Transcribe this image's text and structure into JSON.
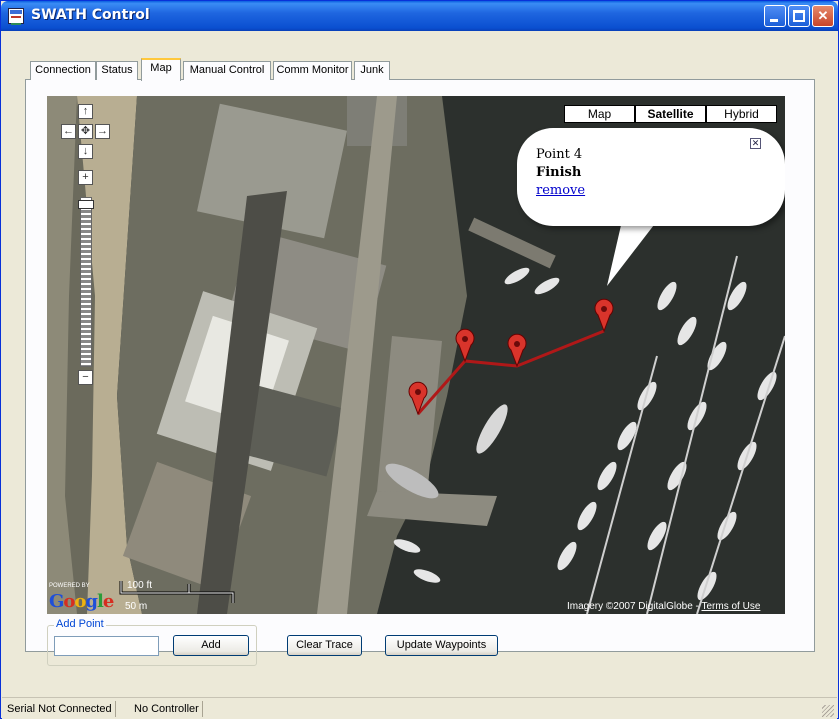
{
  "window": {
    "title": "SWATH Control"
  },
  "tabs": [
    {
      "label": "Connection"
    },
    {
      "label": "Status"
    },
    {
      "label": "Map"
    },
    {
      "label": "Manual Control"
    },
    {
      "label": "Comm Monitor"
    },
    {
      "label": "Junk"
    }
  ],
  "active_tab": "Map",
  "map": {
    "type_buttons": [
      "Map",
      "Satellite",
      "Hybrid"
    ],
    "selected_type": "Satellite",
    "info_window": {
      "line1": "Point 4",
      "line2": "Finish",
      "link": "remove"
    },
    "powered_by": "POWERED BY",
    "logo": "Google",
    "scale_ft": "100 ft",
    "scale_m": "50 m",
    "attribution": "Imagery ©2007 DigitalGlobe - ",
    "terms_link": "Terms of Use",
    "waypoint_count": 4,
    "track_color": "#b01818",
    "marker_color": "#d9342b"
  },
  "add_point": {
    "group_label": "Add Point",
    "input_value": "",
    "add_label": "Add"
  },
  "buttons": {
    "clear_trace": "Clear Trace",
    "update_waypoints": "Update Waypoints"
  },
  "status": {
    "serial": "Serial Not Connected",
    "controller": "No Controller"
  },
  "colors": {
    "titlebar": "#0a5fe0",
    "tab_highlight": "#ffc83c",
    "link": "#0000cc"
  }
}
